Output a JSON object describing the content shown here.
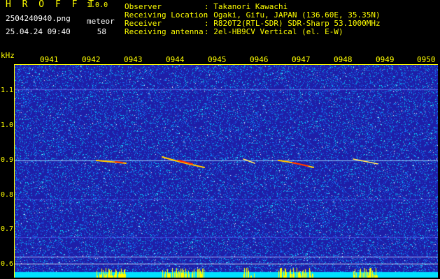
{
  "app": {
    "name": "H R O F F T",
    "version": "1.0.0"
  },
  "file": {
    "name": "2504240940.png",
    "datetime": "25.04.24 09:40"
  },
  "meteor": {
    "label": "meteor",
    "count": "58"
  },
  "info": [
    {
      "key": "Observer",
      "value": ": Takanori Kawachi"
    },
    {
      "key": "Receiving Location",
      "value": ": Ogaki, Gifu, JAPAN (136.60E, 35.35N)"
    },
    {
      "key": "Receiver",
      "value": ": R820T2(RTL-SDR) SDR-Sharp 53.1000MHz"
    },
    {
      "key": "Receiving antenna",
      "value": ": 2el-HB9CV Vertical (el. E-W)"
    }
  ],
  "axis": {
    "y_unit": "kHz",
    "y_ticks": [
      "1.1",
      "1.0",
      "0.9",
      "0.8",
      "0.7",
      "0.6"
    ],
    "x_ticks": [
      "0941",
      "0942",
      "0943",
      "0944",
      "0945",
      "0946",
      "0947",
      "0948",
      "0949",
      "0950"
    ]
  },
  "colors": {
    "label": "#ffff00",
    "background": "#1e1ea8",
    "intensity": "#00ffff"
  }
}
